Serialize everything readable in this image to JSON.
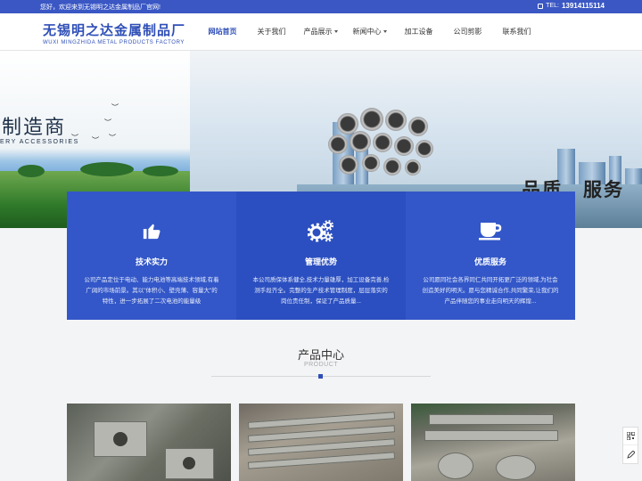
{
  "topbar": {
    "welcome": "您好，欢迎来到无锡明之达金属制品厂官网!",
    "tel_label": "TEL:",
    "tel_number": "13914115114"
  },
  "logo": {
    "cn": "无锡明之达金属制品厂",
    "en": "WUXI MINGZHIDA METAL PRODUCTS FACTORY"
  },
  "nav": {
    "items": [
      {
        "label": "网站首页"
      },
      {
        "label": "关于我们"
      },
      {
        "label": "产品展示"
      },
      {
        "label": "新闻中心"
      },
      {
        "label": "加工设备"
      },
      {
        "label": "公司剪影"
      },
      {
        "label": "联系我们"
      }
    ],
    "active_index": 0
  },
  "banner": {
    "left_title": "制造商",
    "left_subtitle": "ERY ACCESSORIES",
    "slogan": "品质　服务"
  },
  "features": [
    {
      "title": "技术实力",
      "desc": "公司产品定位于电动、能力电池等高端技术领域,有着广阔的市场前景。其以\"体积小、壁壳薄、容量大\"的特性，进一步拓展了二次电池的能量级",
      "icon": "thumbs-up-icon"
    },
    {
      "title": "管理优势",
      "desc": "本公司质保体系健全,技术力量雄厚，加工设备完善,检测手段齐全。完整的生产技术管理制度，层层落实的岗位责任制，保证了产品质量...",
      "icon": "gears-icon"
    },
    {
      "title": "优质服务",
      "desc": "公司愿同社会各界同仁共同开拓更广泛的领域,为社会创造美好的明天。愿与您精诚合作,共同繁荣,让我们的产品伴随您的事业走向明天的辉煌...",
      "icon": "coffee-cup-icon"
    }
  ],
  "products_section": {
    "title": "产品中心",
    "subtitle": "PRODUCT"
  },
  "colors": {
    "brand": "#2f4fb7",
    "feature_blue": "#3357c8"
  }
}
